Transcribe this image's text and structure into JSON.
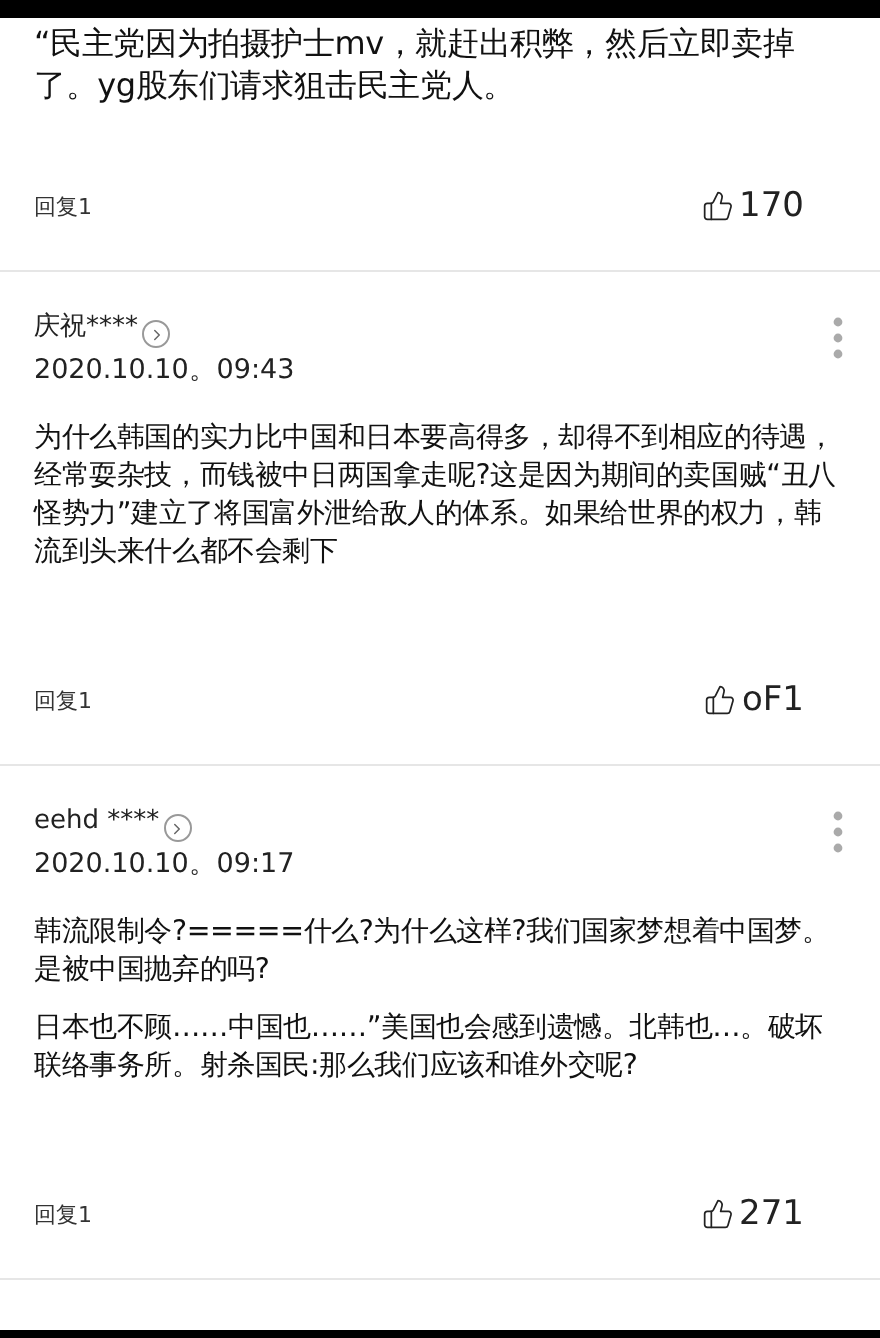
{
  "comments": [
    {
      "body": [
        "“民主党因为拍摄护士mv，就赶出积弊，然后立即卖掉了。yg股东们请求狙击民主党人。"
      ],
      "reply": "回复1",
      "likes": "170"
    },
    {
      "author": "庆祝****",
      "date": "2020.10.10。09:43",
      "body": [
        "为什么韩国的实力比中国和日本要高得多，却得不到相应的待遇，经常耍杂技，而钱被中日两国拿走呢?这是因为期间的卖国贼“丑八怪势力”建立了将国富外泄给敌人的体系。如果给世界的权力，韩流到头来什么都不会剩下"
      ],
      "reply": "回复1",
      "likes": "oF1"
    },
    {
      "author": "eehd ****",
      "date": "2020.10.10。09:17",
      "body": [
        "韩流限制令?=====什么?为什么这样?我们国家梦想着中国梦。是被中国抛弃的吗?",
        "日本也不顾……中国也……”美国也会感到遗憾。北韩也…。破坏联络事务所。射杀国民:那么我们应该和谁外交呢?"
      ],
      "reply": "回复1",
      "likes": "271"
    }
  ]
}
